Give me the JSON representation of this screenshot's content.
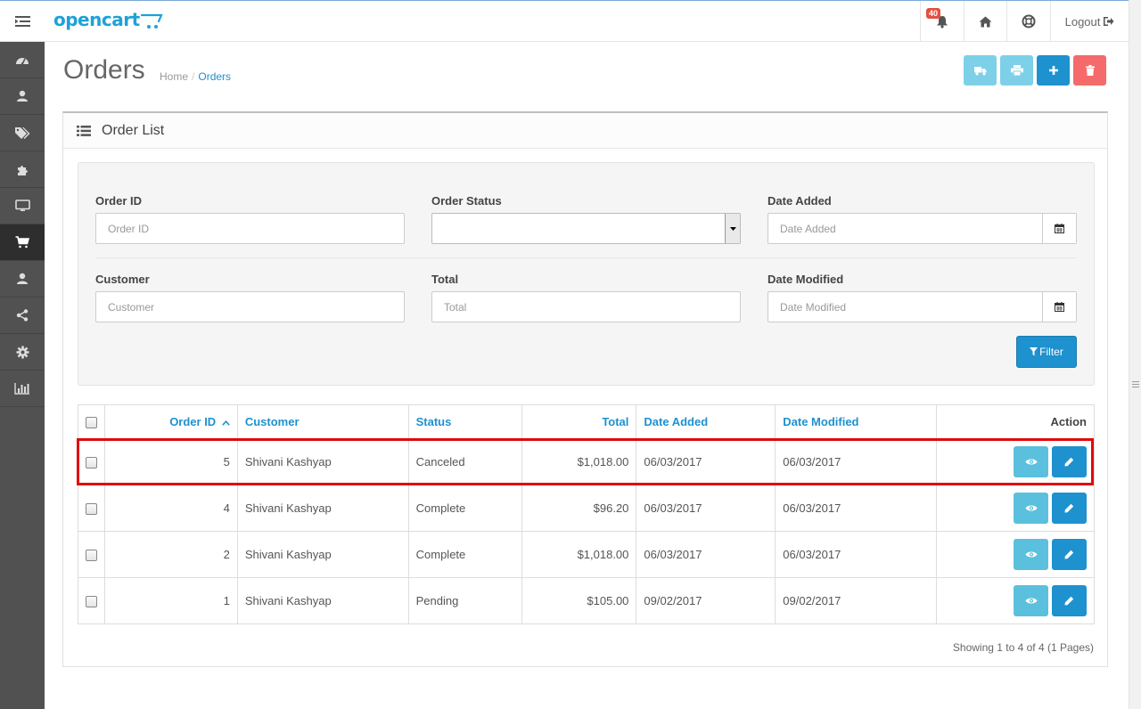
{
  "header": {
    "logo": "opencart",
    "notification_count": "40",
    "logout_label": "Logout"
  },
  "sidebar": {
    "items": [
      {
        "icon": "dashboard-icon"
      },
      {
        "icon": "catalog-icon"
      },
      {
        "icon": "tags-icon"
      },
      {
        "icon": "puzzle-icon"
      },
      {
        "icon": "desktop-icon"
      },
      {
        "icon": "cart-icon",
        "active": true
      },
      {
        "icon": "user-icon"
      },
      {
        "icon": "share-icon"
      },
      {
        "icon": "cog-icon"
      },
      {
        "icon": "bar-chart-icon"
      }
    ]
  },
  "page": {
    "title": "Orders",
    "breadcrumb": [
      "Home",
      "Orders"
    ]
  },
  "panel": {
    "title": "Order List"
  },
  "filter": {
    "order_id_label": "Order ID",
    "order_id_placeholder": "Order ID",
    "order_status_label": "Order Status",
    "order_status_value": "",
    "date_added_label": "Date Added",
    "date_added_placeholder": "Date Added",
    "customer_label": "Customer",
    "customer_placeholder": "Customer",
    "total_label": "Total",
    "total_placeholder": "Total",
    "date_modified_label": "Date Modified",
    "date_modified_placeholder": "Date Modified",
    "filter_button": "Filter"
  },
  "table": {
    "columns": {
      "order_id": "Order ID",
      "customer": "Customer",
      "status": "Status",
      "total": "Total",
      "date_added": "Date Added",
      "date_modified": "Date Modified",
      "action": "Action"
    },
    "rows": [
      {
        "order_id": "5",
        "customer": "Shivani Kashyap",
        "status": "Canceled",
        "total": "$1,018.00",
        "date_added": "06/03/2017",
        "date_modified": "06/03/2017"
      },
      {
        "order_id": "4",
        "customer": "Shivani Kashyap",
        "status": "Complete",
        "total": "$96.20",
        "date_added": "06/03/2017",
        "date_modified": "06/03/2017"
      },
      {
        "order_id": "2",
        "customer": "Shivani Kashyap",
        "status": "Complete",
        "total": "$1,018.00",
        "date_added": "06/03/2017",
        "date_modified": "06/03/2017"
      },
      {
        "order_id": "1",
        "customer": "Shivani Kashyap",
        "status": "Pending",
        "total": "$105.00",
        "date_added": "09/02/2017",
        "date_modified": "09/02/2017"
      }
    ]
  },
  "pagination": {
    "summary": "Showing 1 to 4 of 4 (1 Pages)"
  },
  "colors": {
    "primary": "#1e91cf",
    "info": "#5bc0de",
    "danger": "#f56b6b",
    "sidebar": "#515151",
    "highlight": "#e10a0a"
  }
}
